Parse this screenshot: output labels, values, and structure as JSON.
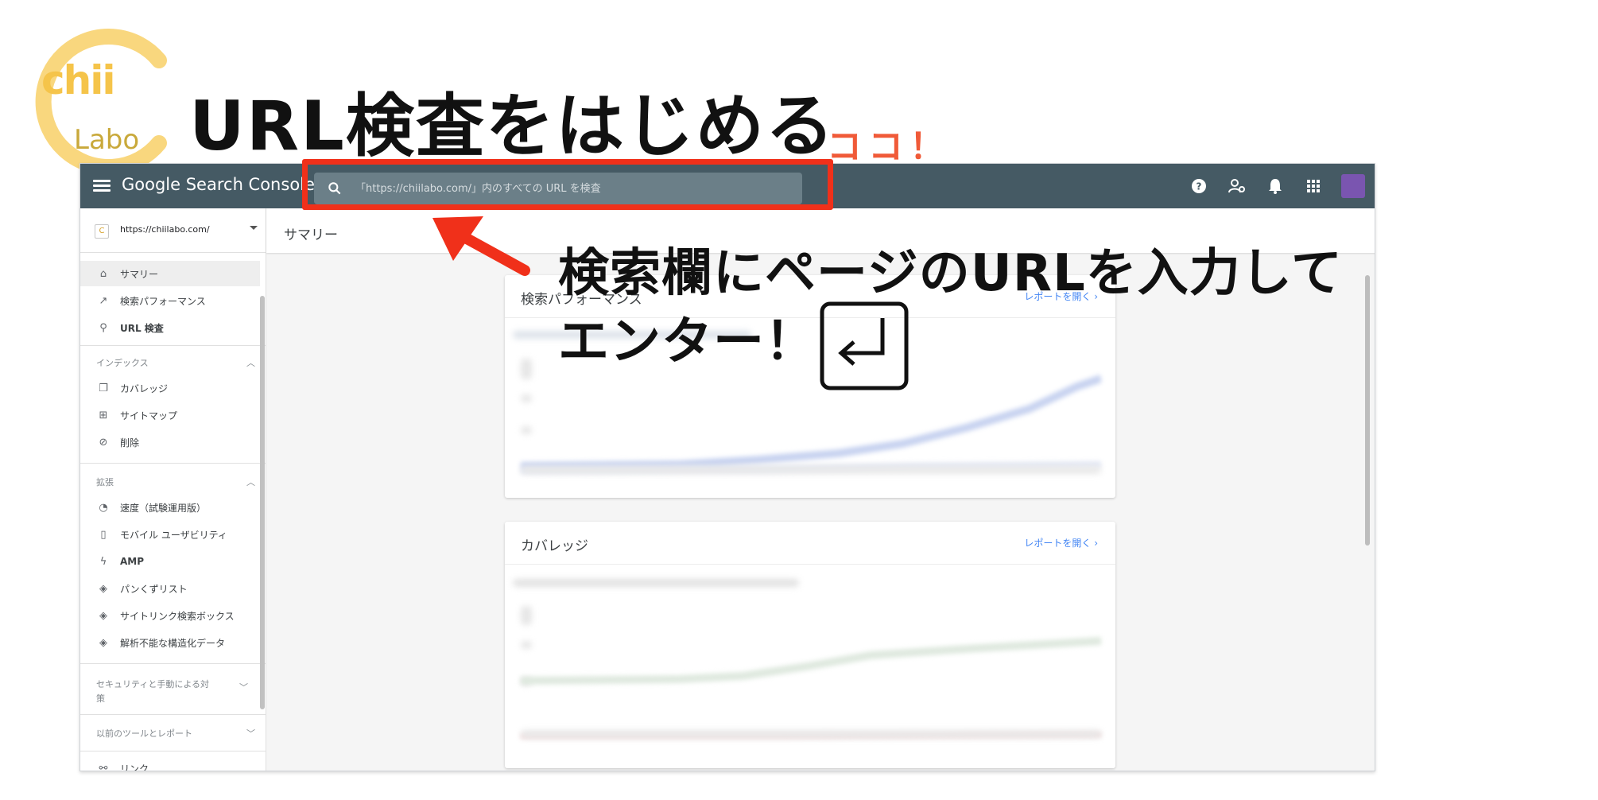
{
  "logo": {
    "text_main": "chii",
    "text_sub": "Labo"
  },
  "headline": "URL検査をはじめる",
  "callout": "ココ！",
  "instruction": {
    "line1": "検索欄にページのURLを入力して",
    "line2": "エンター！"
  },
  "app": {
    "brand": "Google Search Console",
    "search": {
      "placeholder": "「https://chiilabo.com/」内のすべての URL を検査"
    },
    "topbar_icons": [
      "help-icon",
      "user-settings-icon",
      "bell-icon",
      "apps-grid-icon",
      "avatar"
    ],
    "property": {
      "url": "https://chiilabo.com/",
      "icon_letter": "C"
    },
    "nav": {
      "top": [
        {
          "label": "サマリー",
          "icon": "home-icon"
        },
        {
          "label": "検索パフォーマンス",
          "icon": "trend-icon"
        },
        {
          "label": "URL 検査",
          "icon": "search-icon"
        }
      ],
      "index_header": "インデックス",
      "index": [
        {
          "label": "カバレッジ",
          "icon": "copy-icon"
        },
        {
          "label": "サイトマップ",
          "icon": "sitemap-icon"
        },
        {
          "label": "削除",
          "icon": "eye-off-icon"
        }
      ],
      "ext_header": "拡張",
      "ext": [
        {
          "label": "速度（試験運用版）",
          "icon": "speed-icon"
        },
        {
          "label": "モバイル ユーザビリティ",
          "icon": "phone-icon"
        },
        {
          "label": "AMP",
          "icon": "bolt-icon"
        },
        {
          "label": "パンくずリスト",
          "icon": "layers-icon"
        },
        {
          "label": "サイトリンク検索ボックス",
          "icon": "layers-icon"
        },
        {
          "label": "解析不能な構造化データ",
          "icon": "layers-icon"
        }
      ],
      "security_header": "セキュリティと手動による対策",
      "legacy_header": "以前のツールとレポート",
      "links": "リンク"
    },
    "page_title": "サマリー",
    "cards": [
      {
        "title": "検索パフォーマンス",
        "link": "レポートを開く"
      },
      {
        "title": "カバレッジ",
        "link": "レポートを開く"
      }
    ]
  }
}
